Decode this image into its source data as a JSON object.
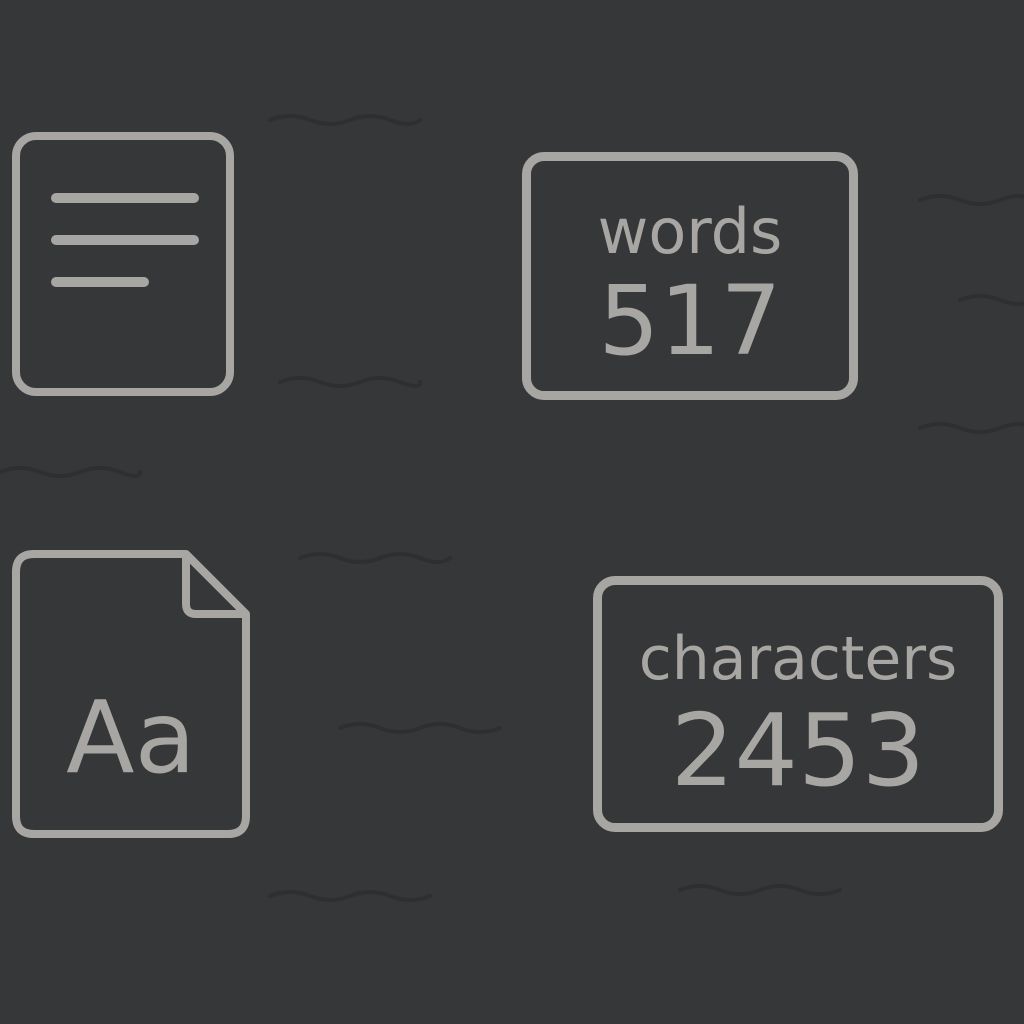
{
  "document_icon": {
    "icon": "document-lines-icon"
  },
  "font_file": {
    "icon": "font-file-icon",
    "label": "Aa"
  },
  "stats": {
    "words": {
      "label": "words",
      "value": "517"
    },
    "characters": {
      "label": "characters",
      "value": "2453"
    }
  },
  "colors": {
    "background": "#363739",
    "foreground": "#a8a6a2"
  }
}
